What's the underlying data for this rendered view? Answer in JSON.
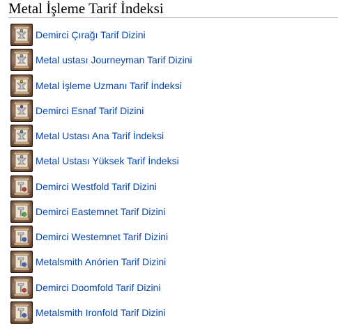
{
  "page": {
    "title": "Metal İşleme Tarif İndeksi"
  },
  "colors": {
    "link": "#0645ad",
    "heading_rule": "#a2a9b1",
    "icon_frame": "#2b1708",
    "icon_bg_light": "#d6c8b8",
    "icon_bg_dark": "#6e4a36",
    "icon_tool": "#bfc6d2"
  },
  "recipes": [
    {
      "label": "Demirci Çırağı Tarif Dizini",
      "icon": "scroll-anvil-icon",
      "emblem_color": "#9aa6b8"
    },
    {
      "label": "Metal ustası Journeyman Tarif Dizini",
      "icon": "scroll-anvil-icon",
      "emblem_color": "#9aa6b8"
    },
    {
      "label": "Metal İşleme Uzmanı Tarif İndeksi",
      "icon": "scroll-anvil-icon",
      "emblem_color": "#d4b020"
    },
    {
      "label": "Demirci Esnaf Tarif Dizini",
      "icon": "scroll-anvil-icon",
      "emblem_color": "#7a4ab8"
    },
    {
      "label": "Metal Ustası Ana Tarif İndeksi",
      "icon": "scroll-anvil-icon",
      "emblem_color": "#3aa0c8"
    },
    {
      "label": "Metal Ustası Yüksek Tarif İndeksi",
      "icon": "scroll-anvil-icon",
      "emblem_color": "#9aa6b8"
    },
    {
      "label": "Demirci Westfold Tarif Dizini",
      "icon": "scroll-hammer-icon",
      "emblem_color": "#c83a3a"
    },
    {
      "label": "Demirci Eastemnet Tarif Dizini",
      "icon": "scroll-hammer-icon",
      "emblem_color": "#3ab83a"
    },
    {
      "label": "Demirci Westemnet Tarif Dizini",
      "icon": "scroll-hammer-icon",
      "emblem_color": "#3a6ac8"
    },
    {
      "label": "Metalsmith Anórien Tarif Dizini",
      "icon": "scroll-hammer-icon",
      "emblem_color": "#3a6ac8"
    },
    {
      "label": "Demirci Doomfold Tarif Dizini",
      "icon": "scroll-hammer-icon",
      "emblem_color": "#c83a3a"
    },
    {
      "label": "Metalsmith Ironfold Tarif Dizini",
      "icon": "scroll-hammer-icon",
      "emblem_color": "#3a6ac8"
    }
  ]
}
